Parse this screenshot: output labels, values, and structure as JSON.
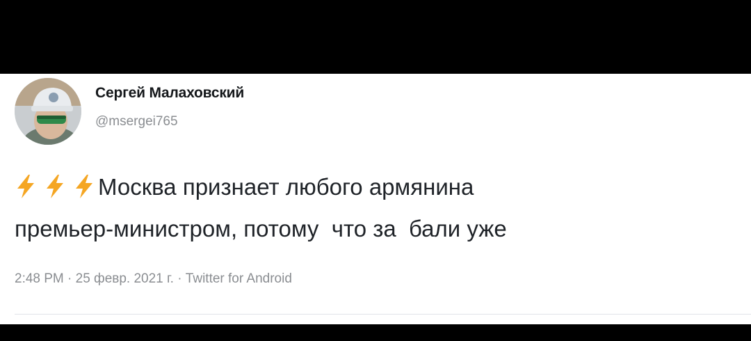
{
  "tweet": {
    "author": {
      "display_name": "Сергей Малаховский",
      "handle": "@msergei765"
    },
    "emoji_icons": [
      "high-voltage-icon",
      "high-voltage-icon",
      "high-voltage-icon"
    ],
    "text_line1": "Москва признает любого армянина",
    "text_line2": "премьер-министром, потому  что за  бали уже",
    "meta": "2:48 PM · 25 февр. 2021 г. · Twitter for Android"
  },
  "colors": {
    "background": "#000000",
    "card": "#ffffff",
    "bolt": "#f5a623",
    "text": "#1f2328",
    "secondary_text": "#8a8d91"
  }
}
